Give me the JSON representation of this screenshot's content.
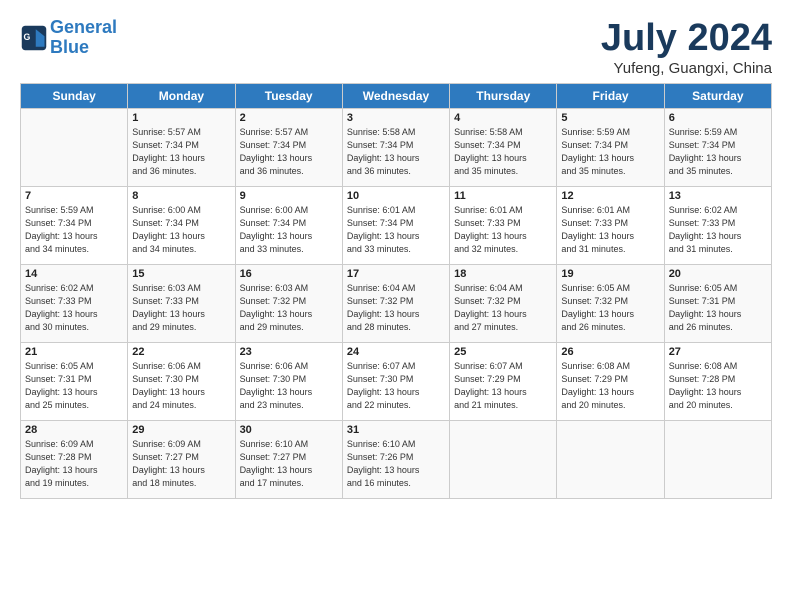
{
  "header": {
    "logo_line1": "General",
    "logo_line2": "Blue",
    "month": "July 2024",
    "location": "Yufeng, Guangxi, China"
  },
  "days_of_week": [
    "Sunday",
    "Monday",
    "Tuesday",
    "Wednesday",
    "Thursday",
    "Friday",
    "Saturday"
  ],
  "weeks": [
    [
      {
        "day": "",
        "text": ""
      },
      {
        "day": "1",
        "text": "Sunrise: 5:57 AM\nSunset: 7:34 PM\nDaylight: 13 hours\nand 36 minutes."
      },
      {
        "day": "2",
        "text": "Sunrise: 5:57 AM\nSunset: 7:34 PM\nDaylight: 13 hours\nand 36 minutes."
      },
      {
        "day": "3",
        "text": "Sunrise: 5:58 AM\nSunset: 7:34 PM\nDaylight: 13 hours\nand 36 minutes."
      },
      {
        "day": "4",
        "text": "Sunrise: 5:58 AM\nSunset: 7:34 PM\nDaylight: 13 hours\nand 35 minutes."
      },
      {
        "day": "5",
        "text": "Sunrise: 5:59 AM\nSunset: 7:34 PM\nDaylight: 13 hours\nand 35 minutes."
      },
      {
        "day": "6",
        "text": "Sunrise: 5:59 AM\nSunset: 7:34 PM\nDaylight: 13 hours\nand 35 minutes."
      }
    ],
    [
      {
        "day": "7",
        "text": "Sunrise: 5:59 AM\nSunset: 7:34 PM\nDaylight: 13 hours\nand 34 minutes."
      },
      {
        "day": "8",
        "text": "Sunrise: 6:00 AM\nSunset: 7:34 PM\nDaylight: 13 hours\nand 34 minutes."
      },
      {
        "day": "9",
        "text": "Sunrise: 6:00 AM\nSunset: 7:34 PM\nDaylight: 13 hours\nand 33 minutes."
      },
      {
        "day": "10",
        "text": "Sunrise: 6:01 AM\nSunset: 7:34 PM\nDaylight: 13 hours\nand 33 minutes."
      },
      {
        "day": "11",
        "text": "Sunrise: 6:01 AM\nSunset: 7:33 PM\nDaylight: 13 hours\nand 32 minutes."
      },
      {
        "day": "12",
        "text": "Sunrise: 6:01 AM\nSunset: 7:33 PM\nDaylight: 13 hours\nand 31 minutes."
      },
      {
        "day": "13",
        "text": "Sunrise: 6:02 AM\nSunset: 7:33 PM\nDaylight: 13 hours\nand 31 minutes."
      }
    ],
    [
      {
        "day": "14",
        "text": "Sunrise: 6:02 AM\nSunset: 7:33 PM\nDaylight: 13 hours\nand 30 minutes."
      },
      {
        "day": "15",
        "text": "Sunrise: 6:03 AM\nSunset: 7:33 PM\nDaylight: 13 hours\nand 29 minutes."
      },
      {
        "day": "16",
        "text": "Sunrise: 6:03 AM\nSunset: 7:32 PM\nDaylight: 13 hours\nand 29 minutes."
      },
      {
        "day": "17",
        "text": "Sunrise: 6:04 AM\nSunset: 7:32 PM\nDaylight: 13 hours\nand 28 minutes."
      },
      {
        "day": "18",
        "text": "Sunrise: 6:04 AM\nSunset: 7:32 PM\nDaylight: 13 hours\nand 27 minutes."
      },
      {
        "day": "19",
        "text": "Sunrise: 6:05 AM\nSunset: 7:32 PM\nDaylight: 13 hours\nand 26 minutes."
      },
      {
        "day": "20",
        "text": "Sunrise: 6:05 AM\nSunset: 7:31 PM\nDaylight: 13 hours\nand 26 minutes."
      }
    ],
    [
      {
        "day": "21",
        "text": "Sunrise: 6:05 AM\nSunset: 7:31 PM\nDaylight: 13 hours\nand 25 minutes."
      },
      {
        "day": "22",
        "text": "Sunrise: 6:06 AM\nSunset: 7:30 PM\nDaylight: 13 hours\nand 24 minutes."
      },
      {
        "day": "23",
        "text": "Sunrise: 6:06 AM\nSunset: 7:30 PM\nDaylight: 13 hours\nand 23 minutes."
      },
      {
        "day": "24",
        "text": "Sunrise: 6:07 AM\nSunset: 7:30 PM\nDaylight: 13 hours\nand 22 minutes."
      },
      {
        "day": "25",
        "text": "Sunrise: 6:07 AM\nSunset: 7:29 PM\nDaylight: 13 hours\nand 21 minutes."
      },
      {
        "day": "26",
        "text": "Sunrise: 6:08 AM\nSunset: 7:29 PM\nDaylight: 13 hours\nand 20 minutes."
      },
      {
        "day": "27",
        "text": "Sunrise: 6:08 AM\nSunset: 7:28 PM\nDaylight: 13 hours\nand 20 minutes."
      }
    ],
    [
      {
        "day": "28",
        "text": "Sunrise: 6:09 AM\nSunset: 7:28 PM\nDaylight: 13 hours\nand 19 minutes."
      },
      {
        "day": "29",
        "text": "Sunrise: 6:09 AM\nSunset: 7:27 PM\nDaylight: 13 hours\nand 18 minutes."
      },
      {
        "day": "30",
        "text": "Sunrise: 6:10 AM\nSunset: 7:27 PM\nDaylight: 13 hours\nand 17 minutes."
      },
      {
        "day": "31",
        "text": "Sunrise: 6:10 AM\nSunset: 7:26 PM\nDaylight: 13 hours\nand 16 minutes."
      },
      {
        "day": "",
        "text": ""
      },
      {
        "day": "",
        "text": ""
      },
      {
        "day": "",
        "text": ""
      }
    ]
  ]
}
